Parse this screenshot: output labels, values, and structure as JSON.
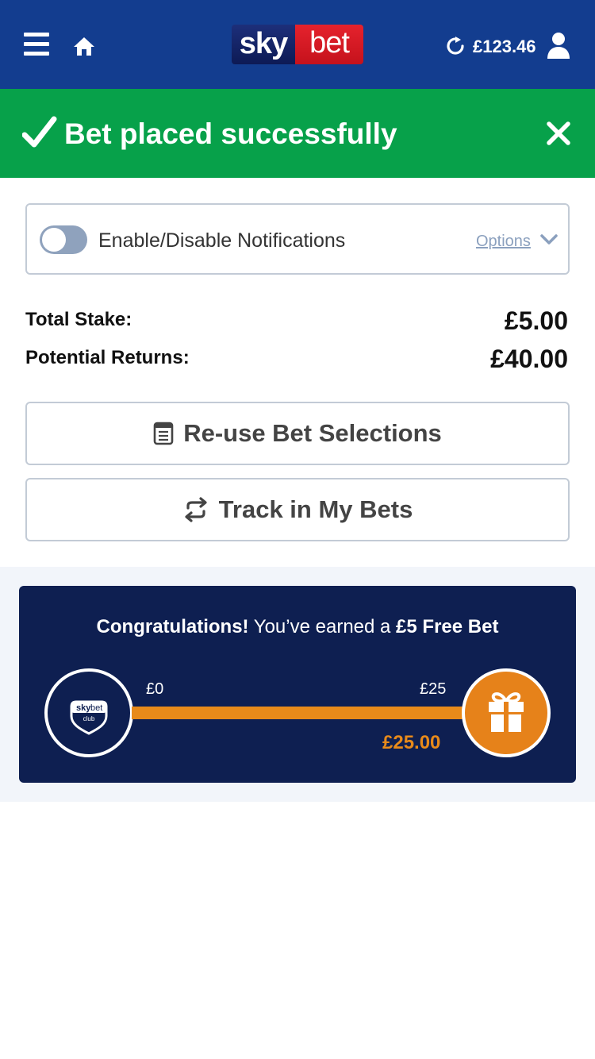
{
  "header": {
    "logo_sky": "sky",
    "logo_bet": "bet",
    "balance": "£123.46",
    "icons": {
      "menu": "hamburger-icon",
      "home": "home-icon",
      "refresh": "refresh-icon",
      "account": "user-icon"
    },
    "colors": {
      "background": "#133d8f",
      "logo_red": "#e5222d"
    }
  },
  "banner": {
    "message": "Bet placed successfully",
    "icons": {
      "status": "check-icon",
      "dismiss": "close-icon"
    },
    "color": "#07a14a"
  },
  "notifications": {
    "label": "Enable/Disable Notifications",
    "enabled": false,
    "options_label": "Options"
  },
  "summary": {
    "total_stake_label": "Total Stake:",
    "total_stake_value": "£5.00",
    "potential_returns_label": "Potential Returns:",
    "potential_returns_value": "£40.00"
  },
  "actions": {
    "reuse_label": "Re-use Bet Selections",
    "track_label": "Track in My Bets",
    "icons": {
      "reuse": "betslip-icon",
      "track": "swap-arrows-icon"
    }
  },
  "promo": {
    "congrats_prefix": "Congratulations!",
    "congrats_middle": " You’ve earned a ",
    "reward": "£5 Free Bet",
    "badge_sky": "sky",
    "badge_bet": "bet",
    "badge_club": "club",
    "range_min": "£0",
    "range_max": "£25",
    "progress_value": "£25.00",
    "progress_fraction": 1.0,
    "colors": {
      "card": "#0e1f51",
      "accent": "#e88a1a"
    }
  }
}
